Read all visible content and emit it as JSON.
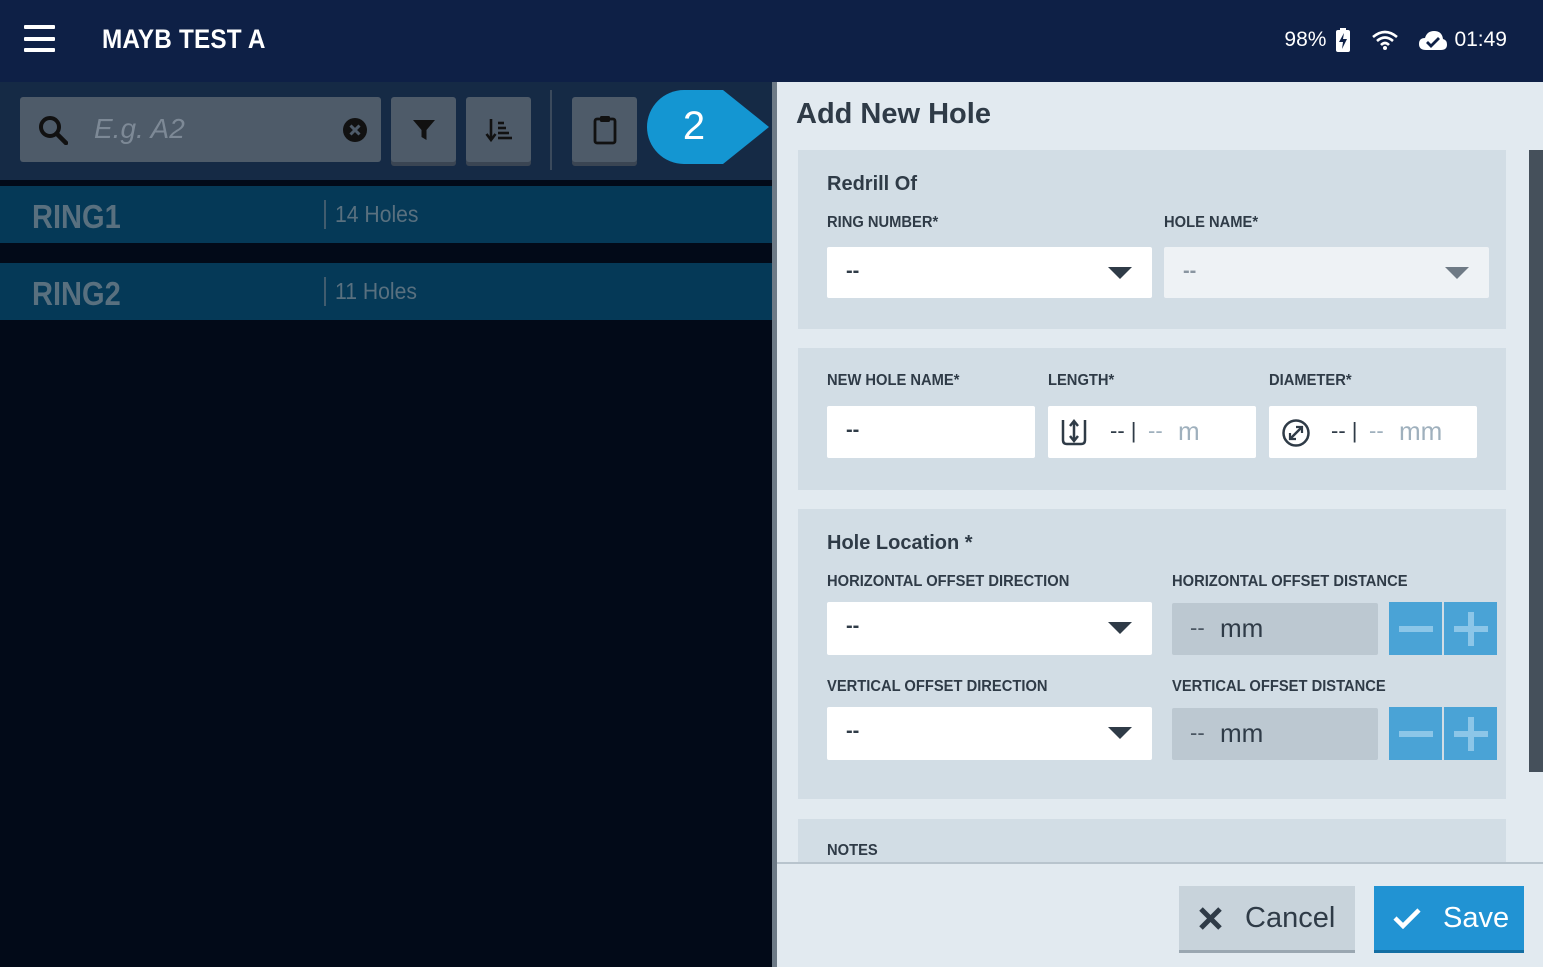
{
  "header": {
    "menu_icon": "hamburger-menu-icon",
    "title": "MAYB TEST A",
    "battery": "98%",
    "battery_icon": "battery-charging-icon",
    "wifi_icon": "wifi-icon",
    "cloud_icon": "cloud-sync-icon",
    "time": "01:49"
  },
  "toolbar": {
    "search_placeholder": "E.g. A2",
    "search_value": "",
    "icons": [
      "search-icon",
      "clear-icon",
      "filter-icon",
      "sort-icon",
      "clipboard-icon"
    ]
  },
  "rings": [
    {
      "name": "RING1",
      "holes": "14 Holes"
    },
    {
      "name": "RING2",
      "holes": "11 Holes"
    }
  ],
  "callout": {
    "number": "2"
  },
  "form": {
    "title": "Add New Hole",
    "redrill": {
      "title": "Redrill Of",
      "ring_number_label": "RING NUMBER*",
      "ring_number_value": "--",
      "hole_name_label": "HOLE NAME*",
      "hole_name_value": "--"
    },
    "hole": {
      "new_hole_name_label": "NEW HOLE NAME*",
      "new_hole_name_value": "--",
      "length_label": "LENGTH*",
      "length_value_a": "-- |",
      "length_value_b": "--",
      "length_unit": "m",
      "diameter_label": "DIAMETER*",
      "diameter_value_a": "-- |",
      "diameter_value_b": "--",
      "diameter_unit": "mm"
    },
    "location": {
      "title": "Hole Location *",
      "h_dir_label": "HORIZONTAL OFFSET DIRECTION",
      "h_dir_value": "--",
      "h_dist_label": "HORIZONTAL OFFSET DISTANCE",
      "h_dist_value": "--",
      "h_dist_unit": "mm",
      "v_dir_label": "VERTICAL OFFSET DIRECTION",
      "v_dir_value": "--",
      "v_dist_label": "VERTICAL OFFSET DISTANCE",
      "v_dist_value": "--",
      "v_dist_unit": "mm"
    },
    "notes_label": "NOTES",
    "cancel_label": "Cancel",
    "save_label": "Save"
  },
  "colors": {
    "topbar": "#0e2046",
    "ring_row": "#053957",
    "accent": "#2193d3",
    "panel_bg": "#e2eaf0",
    "card_bg": "#d2dde5"
  }
}
